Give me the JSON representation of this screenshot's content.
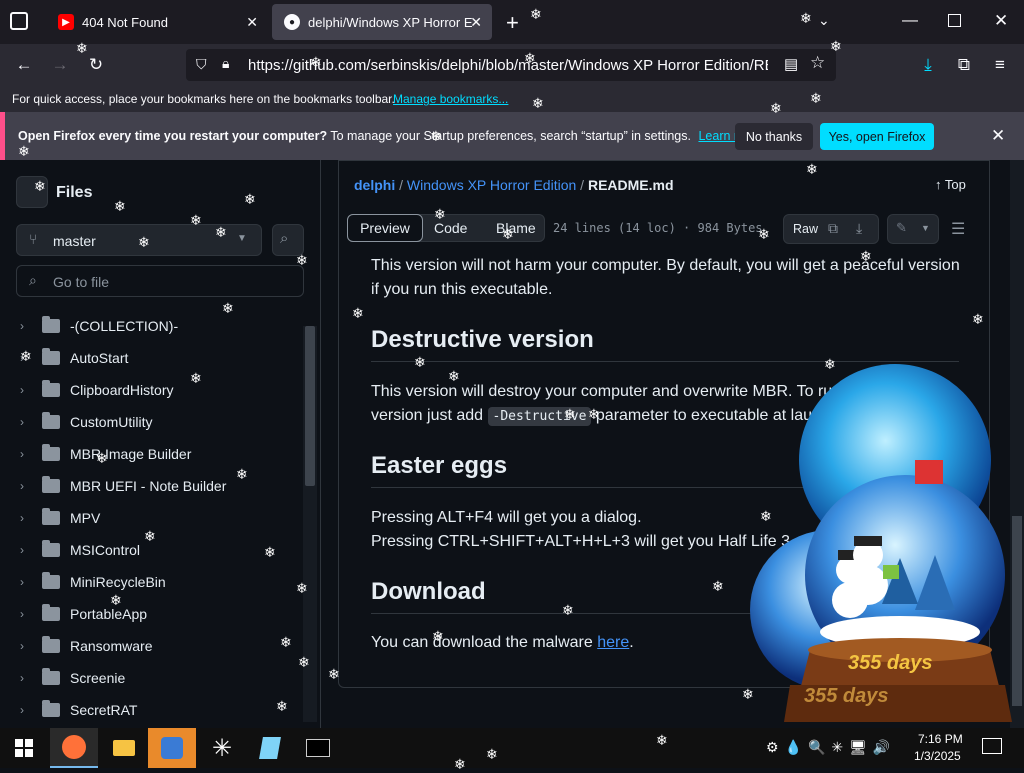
{
  "browser": {
    "tabs": [
      {
        "title": "404 Not Found",
        "active": false
      },
      {
        "title": "delphi/Windows XP Horror Editi",
        "active": true
      }
    ],
    "url": "https://github.com/serbinskis/delphi/blob/master/Windows XP Horror Edition/README",
    "bookmarks_text": "For quick access, place your bookmarks here on the bookmarks toolbar.",
    "bookmarks_link": "Manage bookmarks...",
    "notification": {
      "bold": "Open Firefox every time you restart your computer?",
      "text": "To manage your Startup preferences, search “startup” in settings.",
      "learn_more": "Learn more",
      "no_thanks": "No thanks",
      "yes_open": "Yes, open Firefox"
    }
  },
  "sidebar": {
    "title": "Files",
    "branch": "master",
    "search_placeholder": "Go to file",
    "items": [
      "-(COLLECTION)-",
      "AutoStart",
      "ClipboardHistory",
      "CustomUtility",
      "MBR Image Builder",
      "MBR UEFI - Note Builder",
      "MPV",
      "MSIControl",
      "MiniRecycleBin",
      "PortableApp",
      "Ransomware",
      "Screenie",
      "SecretRAT"
    ]
  },
  "file": {
    "breadcrumb": {
      "repo": "delphi",
      "sep": "/",
      "folder": "Windows XP Horror Edition",
      "file": "README.md"
    },
    "top_label": "Top",
    "tabs": [
      "Preview",
      "Code",
      "Blame"
    ],
    "meta": "24 lines (14 loc) · 984 Bytes",
    "raw_label": "Raw"
  },
  "readme": {
    "intro": "This version will not harm your computer. By default, you will get a peaceful version if you run this executable.",
    "h_destructive": "Destructive version",
    "destructive_text_1": "This version will destroy your computer and overwrite MBR. To run",
    "destructive_text_2a": "version just add",
    "destructive_code": "-Destructive",
    "destructive_text_2b": "parameter to executable at lau",
    "h_easter": "Easter eggs",
    "easter_1": "Pressing ALT+F4 will get you a dialog.",
    "easter_2": "Pressing CTRL+SHIFT+ALT+H+L+3 will get you Half Life 3",
    "h_download": "Download",
    "download_text": "You can download the malware",
    "download_link": "here",
    "download_end": "."
  },
  "overlay": {
    "globe_label_1": "355 days",
    "globe_label_2": "355 days"
  },
  "taskbar": {
    "time": "7:16 PM",
    "date": "1/3/2025"
  },
  "colors": {
    "accent": "#00ddff",
    "link": "#4493f8",
    "notif_bar": "#ff4f8a"
  }
}
